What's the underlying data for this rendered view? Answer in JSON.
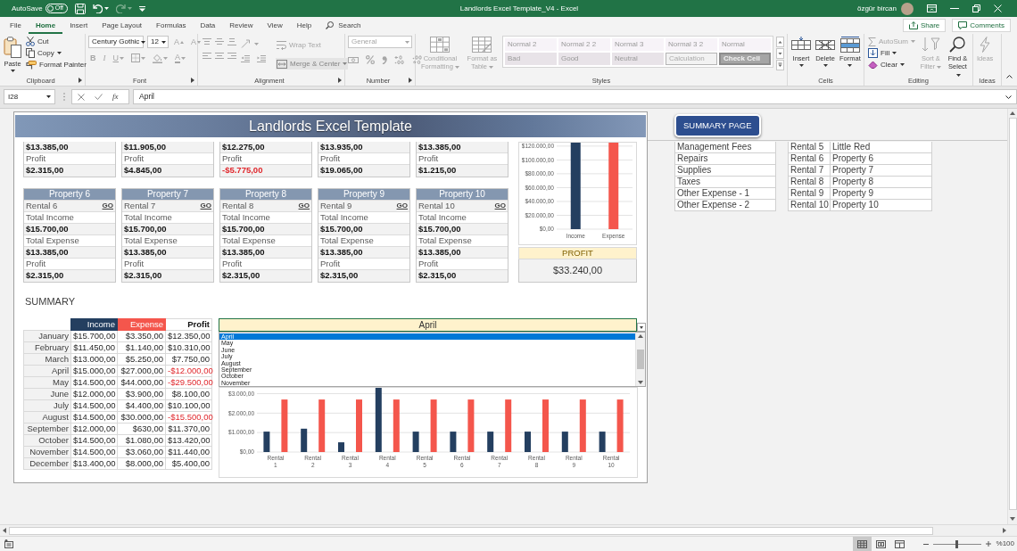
{
  "title_bar": {
    "autosave_label": "AutoSave",
    "autosave": {
      "label": "Off",
      "on": false
    },
    "title": "Landlords Excel Template_V4 - Excel",
    "user": "özgür bircan"
  },
  "tabs": [
    {
      "label": "File",
      "selected": false
    },
    {
      "label": "Home",
      "selected": true
    },
    {
      "label": "Insert",
      "selected": false
    },
    {
      "label": "Page Layout",
      "selected": false
    },
    {
      "label": "Formulas",
      "selected": false
    },
    {
      "label": "Data",
      "selected": false
    },
    {
      "label": "Review",
      "selected": false
    },
    {
      "label": "View",
      "selected": false
    },
    {
      "label": "Help",
      "selected": false
    }
  ],
  "tell_me": {
    "placeholder": "Search"
  },
  "header_buttons": [
    "Share",
    "Comments"
  ],
  "ribbon": {
    "clipboard": {
      "label": "Clipboard",
      "paste": "Paste",
      "cut": "Cut",
      "copy": "Copy",
      "format_painter": "Format Painter"
    },
    "font": {
      "label": "Font",
      "font_name": "Century Gothic",
      "font_size": "12",
      "size_buttons": [
        "A",
        "A"
      ],
      "style_buttons": [
        "B",
        "I",
        "U"
      ],
      "color_button": "A",
      "disabled": true
    },
    "alignment": {
      "label": "Alignment",
      "wrap_text": "Wrap Text",
      "merge_center": "Merge & Center",
      "merge_active": true,
      "disabled": true
    },
    "number": {
      "label": "Number",
      "format": "General",
      "disabled": true
    },
    "styles": {
      "label": "Styles",
      "conditional_formatting": "Conditional Formatting",
      "format_as_table": "Format as Table",
      "disabled": true,
      "cell_styles": [
        {
          "label": "Normal 2",
          "kind": "plain"
        },
        {
          "label": "Normal 2 2",
          "kind": "plain"
        },
        {
          "label": "Normal 3",
          "kind": "plain"
        },
        {
          "label": "Normal 3 2",
          "kind": "plain"
        },
        {
          "label": "Normal",
          "kind": "plain"
        },
        {
          "label": "Bad",
          "kind": "shaded"
        },
        {
          "label": "Good",
          "kind": "shaded"
        },
        {
          "label": "Neutral",
          "kind": "shaded"
        },
        {
          "label": "Calculation",
          "kind": "bordered"
        },
        {
          "label": "Check Cell",
          "kind": "dark"
        }
      ]
    },
    "cells": {
      "label": "Cells",
      "buttons": [
        "Insert",
        "Delete",
        "Format"
      ]
    },
    "editing": {
      "label": "Editing",
      "items": [
        {
          "label": "AutoSum",
          "disabled": true
        },
        {
          "label": "Fill",
          "disabled": false
        },
        {
          "label": "Clear",
          "disabled": false
        },
        {
          "label": "Sort & Filter",
          "disabled": true
        },
        {
          "label": "Find & Select",
          "disabled": false
        }
      ]
    },
    "ideas": {
      "label": "Ideas",
      "button": "Ideas",
      "disabled": true
    }
  },
  "formula_bar": {
    "name_box": "I28",
    "function_label": "fx",
    "formula": "April"
  },
  "sheet": {
    "banner": "Landlords Excel Template",
    "summary_button": "SUMMARY PAGE",
    "partial_cards": [
      {
        "expense": "$13.385,00",
        "profit_label": "Profit",
        "profit": "$2.315,00",
        "negative": false
      },
      {
        "expense": "$11.905,00",
        "profit_label": "Profit",
        "profit": "$4.845,00",
        "negative": false
      },
      {
        "expense": "$12.275,00",
        "profit_label": "Profit",
        "profit": "-$5.775,00",
        "negative": true
      },
      {
        "expense": "$13.935,00",
        "profit_label": "Profit",
        "profit": "$19.065,00",
        "negative": false
      },
      {
        "expense": "$13.385,00",
        "profit_label": "Profit",
        "profit": "$1.215,00",
        "negative": false
      }
    ],
    "cards": [
      {
        "title": "Property 6",
        "rental": "Rental 6",
        "link": "GO",
        "income_label": "Total Income",
        "income": "$15.700,00",
        "expense_label": "Total Expense",
        "expense": "$13.385,00",
        "profit_label": "Profit",
        "profit": "$2.315,00",
        "negative": false
      },
      {
        "title": "Property 7",
        "rental": "Rental 7",
        "link": "GO",
        "income_label": "Total Income",
        "income": "$15.700,00",
        "expense_label": "Total Expense",
        "expense": "$13.385,00",
        "profit_label": "Profit",
        "profit": "$2.315,00",
        "negative": false
      },
      {
        "title": "Property 8",
        "rental": "Rental 8",
        "link": "GO",
        "income_label": "Total Income",
        "income": "$15.700,00",
        "expense_label": "Total Expense",
        "expense": "$13.385,00",
        "profit_label": "Profit",
        "profit": "$2.315,00",
        "negative": false
      },
      {
        "title": "Property 9",
        "rental": "Rental 9",
        "link": "GO",
        "income_label": "Total Income",
        "income": "$15.700,00",
        "expense_label": "Total Expense",
        "expense": "$13.385,00",
        "profit_label": "Profit",
        "profit": "$2.315,00",
        "negative": false
      },
      {
        "title": "Property 10",
        "rental": "Rental 10",
        "link": "GO",
        "income_label": "Total Income",
        "income": "$15.700,00",
        "expense_label": "Total Expense",
        "expense": "$13.385,00",
        "profit_label": "Profit",
        "profit": "$2.315,00",
        "negative": false
      }
    ],
    "totals_chart": {
      "y_labels": [
        "$120.000,00",
        "$100.000,00",
        "$80.000,00",
        "$60.000,00",
        "$40.000,00",
        "$20.000,00",
        "$0,00"
      ],
      "bars": [
        {
          "label": "Income",
          "color": "#243f60"
        },
        {
          "label": "Expense",
          "color": "#f4564c"
        }
      ]
    },
    "profit_label": "PROFIT",
    "profit_total": "$33.240,00",
    "expense_categories": [
      "Management Fees",
      "Repairs",
      "Supplies",
      "Taxes",
      "Other Expense - 1",
      "Other Expense - 2"
    ],
    "rental_names": [
      {
        "rental": "Rental 5",
        "name": "Little Red"
      },
      {
        "rental": "Rental 6",
        "name": "Property 6"
      },
      {
        "rental": "Rental 7",
        "name": "Property 7"
      },
      {
        "rental": "Rental 8",
        "name": "Property 8"
      },
      {
        "rental": "Rental 9",
        "name": "Property 9"
      },
      {
        "rental": "Rental 10",
        "name": "Property 10"
      }
    ],
    "summary_title": "SUMMARY",
    "summary_table": {
      "columns": [
        "Income",
        "Expense",
        "Profit"
      ],
      "rows": [
        {
          "month": "January",
          "income": "$15.700,00",
          "expense": "$3.350,00",
          "profit": "$12.350,00",
          "negative": false
        },
        {
          "month": "February",
          "income": "$11.450,00",
          "expense": "$1.140,00",
          "profit": "$10.310,00",
          "negative": false
        },
        {
          "month": "March",
          "income": "$13.000,00",
          "expense": "$5.250,00",
          "profit": "$7.750,00",
          "negative": false
        },
        {
          "month": "April",
          "income": "$15.000,00",
          "expense": "$27.000,00",
          "profit": "-$12.000,00",
          "negative": true
        },
        {
          "month": "May",
          "income": "$14.500,00",
          "expense": "$44.000,00",
          "profit": "-$29.500,00",
          "negative": true
        },
        {
          "month": "June",
          "income": "$12.000,00",
          "expense": "$3.900,00",
          "profit": "$8.100,00",
          "negative": false
        },
        {
          "month": "July",
          "income": "$14.500,00",
          "expense": "$4.400,00",
          "profit": "$10.100,00",
          "negative": false
        },
        {
          "month": "August",
          "income": "$14.500,00",
          "expense": "$30.000,00",
          "profit": "-$15.500,00",
          "negative": true
        },
        {
          "month": "September",
          "income": "$12.000,00",
          "expense": "$630,00",
          "profit": "$11.370,00",
          "negative": false
        },
        {
          "month": "October",
          "income": "$14.500,00",
          "expense": "$1.080,00",
          "profit": "$13.420,00",
          "negative": false
        },
        {
          "month": "November",
          "income": "$14.500,00",
          "expense": "$3.060,00",
          "profit": "$11.440,00",
          "negative": false
        },
        {
          "month": "December",
          "income": "$13.400,00",
          "expense": "$8.000,00",
          "profit": "$5.400,00",
          "negative": false
        }
      ]
    },
    "month_picker": {
      "value": "April",
      "options": [
        {
          "label": "April",
          "selected": true
        },
        {
          "label": "May",
          "selected": false
        },
        {
          "label": "June",
          "selected": false
        },
        {
          "label": "July",
          "selected": false
        },
        {
          "label": "August",
          "selected": false
        },
        {
          "label": "September",
          "selected": false
        },
        {
          "label": "October",
          "selected": false
        },
        {
          "label": "November",
          "selected": false
        }
      ]
    },
    "rental_chart": {
      "chart_data": {
        "type": "bar",
        "categories": [
          "Rental 1",
          "Rental 2",
          "Rental 3",
          "Rental 4",
          "Rental 5",
          "Rental 6",
          "Rental 7",
          "Rental 8",
          "Rental 9",
          "Rental 10"
        ],
        "series": [
          {
            "color": "#243f60",
            "values": [
              1050,
              1200,
              500,
              3300,
              1050,
              1050,
              1050,
              1050,
              1050,
              1050
            ]
          },
          {
            "color": "#f4564c",
            "values": [
              2700,
              2700,
              2700,
              2700,
              2700,
              2700,
              2700,
              2700,
              2700,
              2700
            ]
          }
        ],
        "ylim": [
          0,
          3300
        ],
        "yticks": [
          {
            "value": 0,
            "label": "$0,00"
          },
          {
            "value": 1000,
            "label": "$1.000,00"
          },
          {
            "value": 2000,
            "label": "$2.000,00"
          },
          {
            "value": 3000,
            "label": "$3.000,00"
          }
        ],
        "grid": true
      }
    }
  },
  "status_bar": {
    "views": [
      {
        "selected": true
      },
      {
        "selected": false
      },
      {
        "selected": false
      }
    ],
    "zoom": {
      "level": 0.5
    },
    "zoom_label": "%100"
  }
}
